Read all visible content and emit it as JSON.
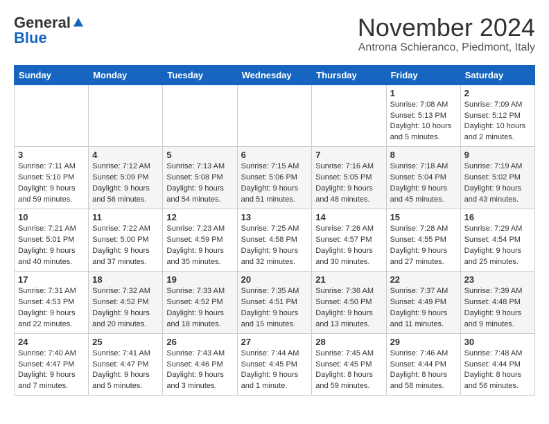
{
  "header": {
    "logo_general": "General",
    "logo_blue": "Blue",
    "month": "November 2024",
    "location": "Antrona Schieranco, Piedmont, Italy"
  },
  "weekdays": [
    "Sunday",
    "Monday",
    "Tuesday",
    "Wednesday",
    "Thursday",
    "Friday",
    "Saturday"
  ],
  "weeks": [
    [
      {
        "day": "",
        "info": ""
      },
      {
        "day": "",
        "info": ""
      },
      {
        "day": "",
        "info": ""
      },
      {
        "day": "",
        "info": ""
      },
      {
        "day": "",
        "info": ""
      },
      {
        "day": "1",
        "info": "Sunrise: 7:08 AM\nSunset: 5:13 PM\nDaylight: 10 hours\nand 5 minutes."
      },
      {
        "day": "2",
        "info": "Sunrise: 7:09 AM\nSunset: 5:12 PM\nDaylight: 10 hours\nand 2 minutes."
      }
    ],
    [
      {
        "day": "3",
        "info": "Sunrise: 7:11 AM\nSunset: 5:10 PM\nDaylight: 9 hours\nand 59 minutes."
      },
      {
        "day": "4",
        "info": "Sunrise: 7:12 AM\nSunset: 5:09 PM\nDaylight: 9 hours\nand 56 minutes."
      },
      {
        "day": "5",
        "info": "Sunrise: 7:13 AM\nSunset: 5:08 PM\nDaylight: 9 hours\nand 54 minutes."
      },
      {
        "day": "6",
        "info": "Sunrise: 7:15 AM\nSunset: 5:06 PM\nDaylight: 9 hours\nand 51 minutes."
      },
      {
        "day": "7",
        "info": "Sunrise: 7:16 AM\nSunset: 5:05 PM\nDaylight: 9 hours\nand 48 minutes."
      },
      {
        "day": "8",
        "info": "Sunrise: 7:18 AM\nSunset: 5:04 PM\nDaylight: 9 hours\nand 45 minutes."
      },
      {
        "day": "9",
        "info": "Sunrise: 7:19 AM\nSunset: 5:02 PM\nDaylight: 9 hours\nand 43 minutes."
      }
    ],
    [
      {
        "day": "10",
        "info": "Sunrise: 7:21 AM\nSunset: 5:01 PM\nDaylight: 9 hours\nand 40 minutes."
      },
      {
        "day": "11",
        "info": "Sunrise: 7:22 AM\nSunset: 5:00 PM\nDaylight: 9 hours\nand 37 minutes."
      },
      {
        "day": "12",
        "info": "Sunrise: 7:23 AM\nSunset: 4:59 PM\nDaylight: 9 hours\nand 35 minutes."
      },
      {
        "day": "13",
        "info": "Sunrise: 7:25 AM\nSunset: 4:58 PM\nDaylight: 9 hours\nand 32 minutes."
      },
      {
        "day": "14",
        "info": "Sunrise: 7:26 AM\nSunset: 4:57 PM\nDaylight: 9 hours\nand 30 minutes."
      },
      {
        "day": "15",
        "info": "Sunrise: 7:28 AM\nSunset: 4:55 PM\nDaylight: 9 hours\nand 27 minutes."
      },
      {
        "day": "16",
        "info": "Sunrise: 7:29 AM\nSunset: 4:54 PM\nDaylight: 9 hours\nand 25 minutes."
      }
    ],
    [
      {
        "day": "17",
        "info": "Sunrise: 7:31 AM\nSunset: 4:53 PM\nDaylight: 9 hours\nand 22 minutes."
      },
      {
        "day": "18",
        "info": "Sunrise: 7:32 AM\nSunset: 4:52 PM\nDaylight: 9 hours\nand 20 minutes."
      },
      {
        "day": "19",
        "info": "Sunrise: 7:33 AM\nSunset: 4:52 PM\nDaylight: 9 hours\nand 18 minutes."
      },
      {
        "day": "20",
        "info": "Sunrise: 7:35 AM\nSunset: 4:51 PM\nDaylight: 9 hours\nand 15 minutes."
      },
      {
        "day": "21",
        "info": "Sunrise: 7:36 AM\nSunset: 4:50 PM\nDaylight: 9 hours\nand 13 minutes."
      },
      {
        "day": "22",
        "info": "Sunrise: 7:37 AM\nSunset: 4:49 PM\nDaylight: 9 hours\nand 11 minutes."
      },
      {
        "day": "23",
        "info": "Sunrise: 7:39 AM\nSunset: 4:48 PM\nDaylight: 9 hours\nand 9 minutes."
      }
    ],
    [
      {
        "day": "24",
        "info": "Sunrise: 7:40 AM\nSunset: 4:47 PM\nDaylight: 9 hours\nand 7 minutes."
      },
      {
        "day": "25",
        "info": "Sunrise: 7:41 AM\nSunset: 4:47 PM\nDaylight: 9 hours\nand 5 minutes."
      },
      {
        "day": "26",
        "info": "Sunrise: 7:43 AM\nSunset: 4:46 PM\nDaylight: 9 hours\nand 3 minutes."
      },
      {
        "day": "27",
        "info": "Sunrise: 7:44 AM\nSunset: 4:45 PM\nDaylight: 9 hours\nand 1 minute."
      },
      {
        "day": "28",
        "info": "Sunrise: 7:45 AM\nSunset: 4:45 PM\nDaylight: 8 hours\nand 59 minutes."
      },
      {
        "day": "29",
        "info": "Sunrise: 7:46 AM\nSunset: 4:44 PM\nDaylight: 8 hours\nand 58 minutes."
      },
      {
        "day": "30",
        "info": "Sunrise: 7:48 AM\nSunset: 4:44 PM\nDaylight: 8 hours\nand 56 minutes."
      }
    ]
  ]
}
